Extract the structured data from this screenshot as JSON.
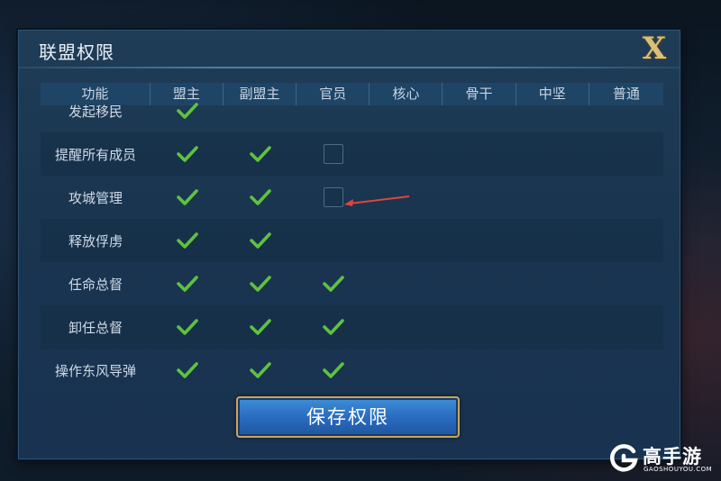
{
  "dialog": {
    "title": "联盟权限",
    "close_label": "X",
    "save_label": "保存权限"
  },
  "table": {
    "headers": [
      "功能",
      "盟主",
      "副盟主",
      "官员",
      "核心",
      "骨干",
      "中坚",
      "普通"
    ],
    "rows": [
      {
        "feature": "发起移民",
        "perms": [
          "check",
          "",
          "",
          "",
          "",
          "",
          ""
        ]
      },
      {
        "feature": "提醒所有成员",
        "perms": [
          "check",
          "check",
          "box",
          "",
          "",
          "",
          ""
        ]
      },
      {
        "feature": "攻城管理",
        "perms": [
          "check",
          "check",
          "box",
          "",
          "",
          "",
          ""
        ]
      },
      {
        "feature": "释放俘虏",
        "perms": [
          "check",
          "check",
          "",
          "",
          "",
          "",
          ""
        ]
      },
      {
        "feature": "任命总督",
        "perms": [
          "check",
          "check",
          "check",
          "",
          "",
          "",
          ""
        ]
      },
      {
        "feature": "卸任总督",
        "perms": [
          "check",
          "check",
          "check",
          "",
          "",
          "",
          ""
        ]
      },
      {
        "feature": "操作东风导弹",
        "perms": [
          "check",
          "check",
          "check",
          "",
          "",
          "",
          ""
        ]
      }
    ]
  },
  "watermark": {
    "name": "高手游",
    "domain": "GAOSHOUYOU.COM"
  },
  "colors": {
    "check": "#5fc23e",
    "annotation_arrow": "#e0443c"
  }
}
